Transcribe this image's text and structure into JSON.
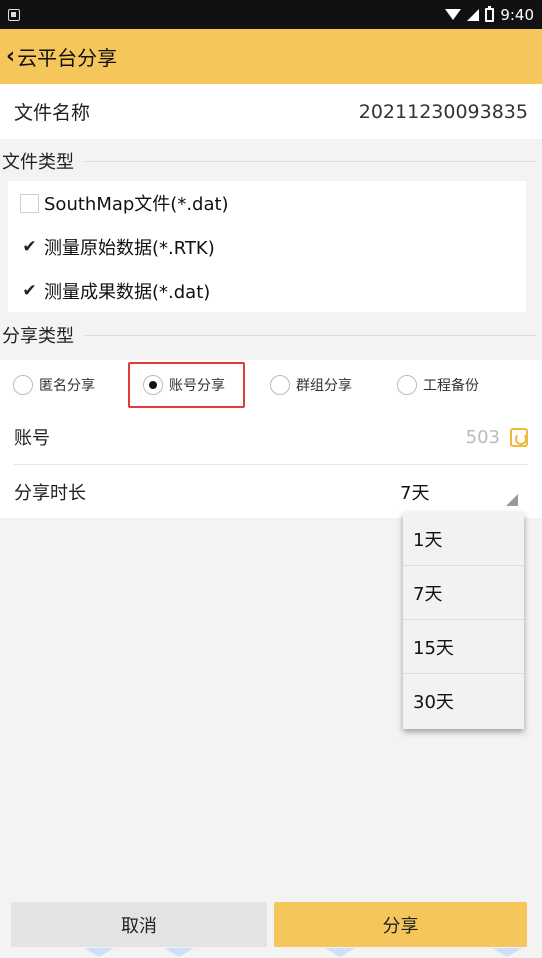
{
  "status_bar": {
    "time": "9:40"
  },
  "header": {
    "back_icon": "chevron-left-icon",
    "title": "云平台分享"
  },
  "file_name": {
    "label": "文件名称",
    "value": "20211230093835"
  },
  "file_type": {
    "header": "文件类型",
    "options": [
      {
        "label": "SouthMap文件(*.dat)",
        "checked": false
      },
      {
        "label": "测量原始数据(*.RTK)",
        "checked": true
      },
      {
        "label": "测量成果数据(*.dat)",
        "checked": true
      }
    ]
  },
  "share_type": {
    "header": "分享类型",
    "options": [
      {
        "label": "匿名分享",
        "selected": false
      },
      {
        "label": "账号分享",
        "selected": true
      },
      {
        "label": "群组分享",
        "selected": false
      },
      {
        "label": "工程备份",
        "selected": false
      }
    ],
    "highlight_color": "#e03a3a"
  },
  "account": {
    "label": "账号",
    "value": "503",
    "icon": "contacts-book-icon"
  },
  "duration": {
    "label": "分享时长",
    "value": "7天",
    "options": [
      "1天",
      "7天",
      "15天",
      "30天"
    ]
  },
  "buttons": {
    "cancel": "取消",
    "share": "分享"
  },
  "colors": {
    "accent": "#f5c65c",
    "cancel_bg": "#e3e3e3"
  }
}
